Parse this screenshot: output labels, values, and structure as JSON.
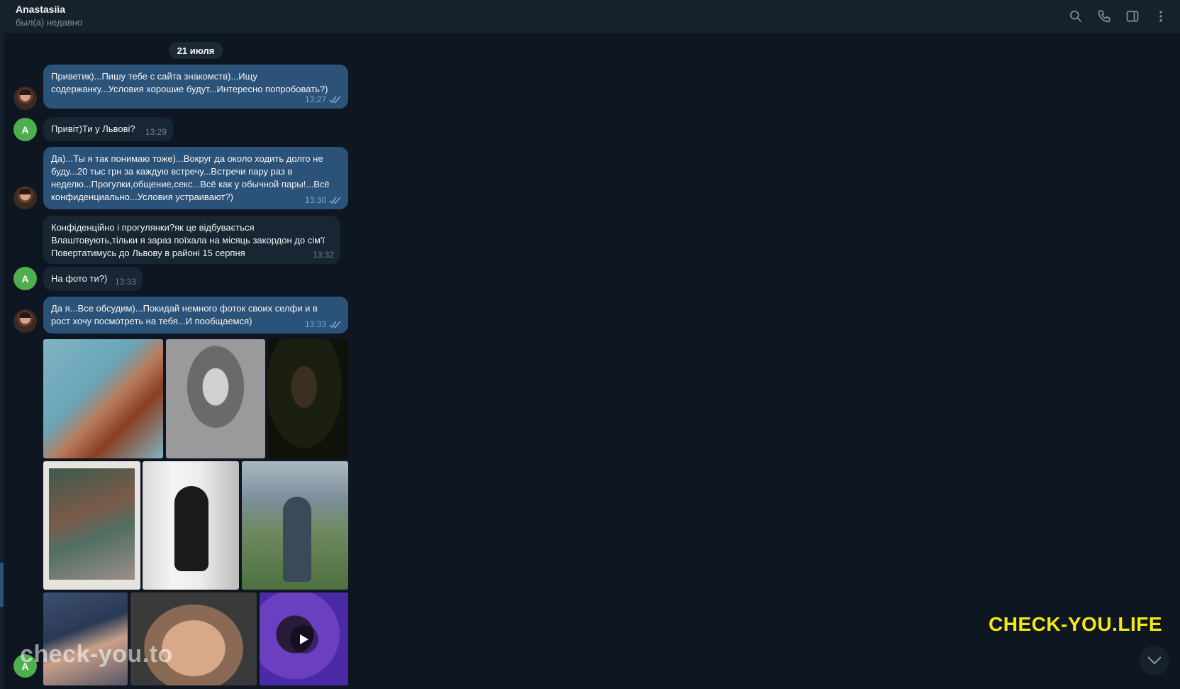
{
  "header": {
    "contact_name": "Anastasiia",
    "status": "был(а) недавно",
    "icons": [
      "search-icon",
      "phone-icon",
      "sidebar-toggle-icon",
      "more-vertical-icon"
    ]
  },
  "chat": {
    "date_separator": "21 июля",
    "messages": [
      {
        "direction": "out",
        "text": "Приветик)...Пишу тебе с сайта знакомств)...Ищу\nсодержанку...Условия хорошие будут...Интересно попробовать?)",
        "time": "13:27",
        "read": true
      },
      {
        "direction": "in",
        "sender_initial": "A",
        "text": "Привіт)Ти у Львові?",
        "time": "13:29"
      },
      {
        "direction": "out",
        "text": "Да)...Ты я так понимаю тоже)...Вокруг да около ходить долго не\nбуду...20 тыс грн за каждую встречу...Встречи пару раз в\nнеделю...Прогулки,общение,секс...Всё как у обычной пары!...Всё\nконфиденциально...Условия устраивают?)",
        "time": "13:30",
        "read": true
      },
      {
        "direction": "in",
        "text": "Конфіденційно і прогулянки?як це відбувається\nВлаштовують,тільки я зараз поїхала на місяць закордон до сім'ї\nПовертатимусь до Львову в районі 15 серпня",
        "time": "13:32"
      },
      {
        "direction": "in",
        "sender_initial": "A",
        "text": "На фото ти?)",
        "time": "13:33"
      },
      {
        "direction": "out",
        "text": "Да я...Все обсудим)...Покидай немного фоток своих селфи и в\nрост хочу посмотреть на тебя...И пообщаемся)",
        "time": "13:33",
        "read": true
      }
    ],
    "last_sender_initial": "A"
  },
  "watermarks": {
    "left": "check-you.to",
    "right": "CHECK-YOU.LIFE",
    "right_color": "#f7e813"
  },
  "colors": {
    "background": "#0e1621",
    "header": "#17212b",
    "outgoing_bubble": "#2b5278",
    "incoming_bubble": "#182533",
    "avatar_green": "#4fae4e"
  }
}
